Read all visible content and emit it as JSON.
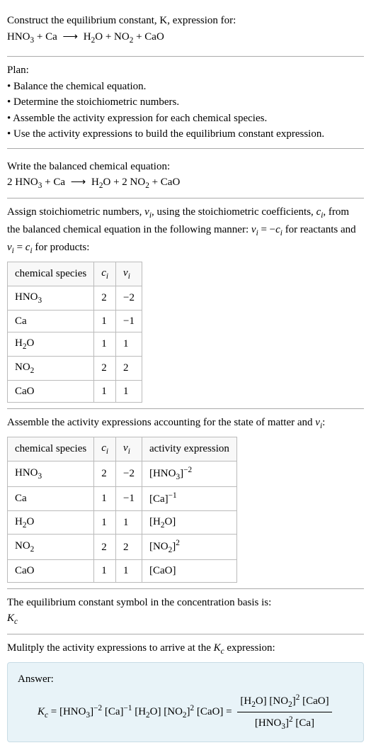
{
  "header": {
    "prompt": "Construct the equilibrium constant, K, expression for:",
    "equation_left": "HNO₃ + Ca",
    "equation_right": "H₂O + NO₂ + CaO",
    "arrow": "⟶"
  },
  "plan": {
    "title": "Plan:",
    "items": [
      "• Balance the chemical equation.",
      "• Determine the stoichiometric numbers.",
      "• Assemble the activity expression for each chemical species.",
      "• Use the activity expressions to build the equilibrium constant expression."
    ]
  },
  "balanced": {
    "title": "Write the balanced chemical equation:",
    "equation_left": "2 HNO₃ + Ca",
    "equation_right": "H₂O + 2 NO₂ + CaO",
    "arrow": "⟶"
  },
  "stoich_intro": "Assign stoichiometric numbers, νᵢ, using the stoichiometric coefficients, cᵢ, from the balanced chemical equation in the following manner: νᵢ = −cᵢ for reactants and νᵢ = cᵢ for products:",
  "stoich_table": {
    "headers": [
      "chemical species",
      "cᵢ",
      "νᵢ"
    ],
    "rows": [
      [
        "HNO₃",
        "2",
        "−2"
      ],
      [
        "Ca",
        "1",
        "−1"
      ],
      [
        "H₂O",
        "1",
        "1"
      ],
      [
        "NO₂",
        "2",
        "2"
      ],
      [
        "CaO",
        "1",
        "1"
      ]
    ]
  },
  "activity_intro": "Assemble the activity expressions accounting for the state of matter and νᵢ:",
  "activity_table": {
    "headers": [
      "chemical species",
      "cᵢ",
      "νᵢ",
      "activity expression"
    ],
    "rows": [
      [
        "HNO₃",
        "2",
        "−2",
        "[HNO₃]⁻²"
      ],
      [
        "Ca",
        "1",
        "−1",
        "[Ca]⁻¹"
      ],
      [
        "H₂O",
        "1",
        "1",
        "[H₂O]"
      ],
      [
        "NO₂",
        "2",
        "2",
        "[NO₂]²"
      ],
      [
        "CaO",
        "1",
        "1",
        "[CaO]"
      ]
    ]
  },
  "symbol": {
    "line1": "The equilibrium constant symbol in the concentration basis is:",
    "line2": "K_c"
  },
  "multiply_intro": "Mulitply the activity expressions to arrive at the K_c expression:",
  "answer": {
    "label": "Answer:",
    "kc": "K_c",
    "eq1": " = [HNO₃]⁻² [Ca]⁻¹ [H₂O] [NO₂]² [CaO] = ",
    "frac_num": "[H₂O] [NO₂]² [CaO]",
    "frac_den": "[HNO₃]² [Ca]"
  },
  "chart_data": {
    "type": "table",
    "tables": [
      {
        "title": "Stoichiometric numbers",
        "columns": [
          "chemical species",
          "c_i",
          "ν_i"
        ],
        "rows": [
          {
            "chemical species": "HNO3",
            "c_i": 2,
            "ν_i": -2
          },
          {
            "chemical species": "Ca",
            "c_i": 1,
            "ν_i": -1
          },
          {
            "chemical species": "H2O",
            "c_i": 1,
            "ν_i": 1
          },
          {
            "chemical species": "NO2",
            "c_i": 2,
            "ν_i": 2
          },
          {
            "chemical species": "CaO",
            "c_i": 1,
            "ν_i": 1
          }
        ]
      },
      {
        "title": "Activity expressions",
        "columns": [
          "chemical species",
          "c_i",
          "ν_i",
          "activity expression"
        ],
        "rows": [
          {
            "chemical species": "HNO3",
            "c_i": 2,
            "ν_i": -2,
            "activity expression": "[HNO3]^-2"
          },
          {
            "chemical species": "Ca",
            "c_i": 1,
            "ν_i": -1,
            "activity expression": "[Ca]^-1"
          },
          {
            "chemical species": "H2O",
            "c_i": 1,
            "ν_i": 1,
            "activity expression": "[H2O]"
          },
          {
            "chemical species": "NO2",
            "c_i": 2,
            "ν_i": 2,
            "activity expression": "[NO2]^2"
          },
          {
            "chemical species": "CaO",
            "c_i": 1,
            "ν_i": 1,
            "activity expression": "[CaO]"
          }
        ]
      }
    ]
  }
}
